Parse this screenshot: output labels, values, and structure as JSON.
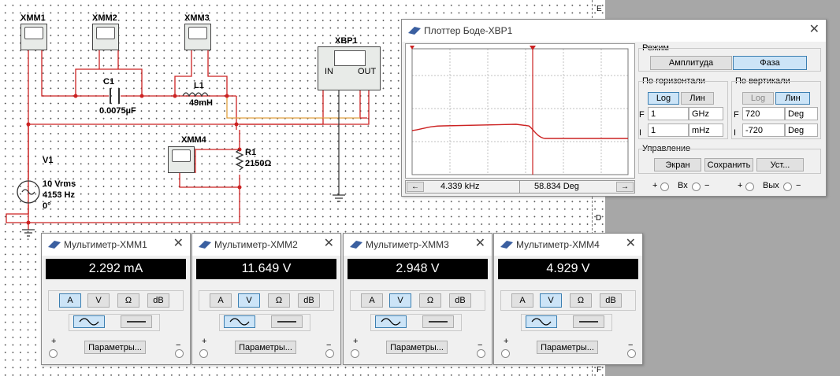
{
  "circuit": {
    "xmm1": "XMM1",
    "xmm2": "XMM2",
    "xmm3": "XMM3",
    "xmm4": "XMM4",
    "xbp1": "XBP1",
    "xbp_in": "IN",
    "xbp_out": "OUT",
    "c1_name": "C1",
    "c1_value": "0.0075µF",
    "l1_name": "L1",
    "l1_value": "49mH",
    "r1_name": "R1",
    "r1_value": "2150Ω",
    "v1_name": "V1",
    "v1_line1": "10 Vrms",
    "v1_line2": "4153 Hz",
    "v1_line3": "0°",
    "sheet_d": "D",
    "sheet_e": "E",
    "sheet_f": "F"
  },
  "bode": {
    "title": "Плоттер Боде-XBP1",
    "mode_label": "Режим",
    "btn_amplitude": "Амплитуда",
    "btn_phase": "Фаза",
    "horizontal_label": "По горизонтали",
    "vertical_label": "По вертикали",
    "h_log": "Log",
    "h_lin": "Лин",
    "v_log": "Log",
    "v_lin": "Лин",
    "h_f_prefix": "F",
    "h_f_value": "1",
    "h_f_unit": "GHz",
    "h_i_prefix": "I",
    "h_i_value": "1",
    "h_i_unit": "mHz",
    "v_f_prefix": "F",
    "v_f_value": "720",
    "v_f_unit": "Deg",
    "v_i_prefix": "I",
    "v_i_value": "-720",
    "v_i_unit": "Deg",
    "control_label": "Управление",
    "btn_screen": "Экран",
    "btn_save": "Сохранить",
    "btn_settings": "Уст...",
    "readout_freq": "4.339 kHz",
    "readout_value": "58.834 Deg",
    "arrow_left": "←",
    "arrow_right": "→",
    "in_plus": "+",
    "in_label": "Вх",
    "in_minus": "−",
    "out_plus": "+",
    "out_label": "Вых",
    "out_minus": "−",
    "close": "✕",
    "colors": {
      "trace": "#cc2222",
      "cursor": "#cc2222",
      "grid": "#bbbbbb"
    }
  },
  "multimeters": [
    {
      "title": "Мультиметр-XMM1",
      "reading": "2.292 mA",
      "active_mode": "A"
    },
    {
      "title": "Мультиметр-XMM2",
      "reading": "11.649 V",
      "active_mode": "V"
    },
    {
      "title": "Мультиметр-XMM3",
      "reading": "2.948 V",
      "active_mode": "V"
    },
    {
      "title": "Мультиметр-XMM4",
      "reading": "4.929 V",
      "active_mode": "V"
    }
  ],
  "mm_common": {
    "mode_a": "A",
    "mode_v": "V",
    "mode_ohm": "Ω",
    "mode_db": "dB",
    "params": "Параметры...",
    "plus": "+",
    "minus": "−",
    "close": "✕"
  }
}
